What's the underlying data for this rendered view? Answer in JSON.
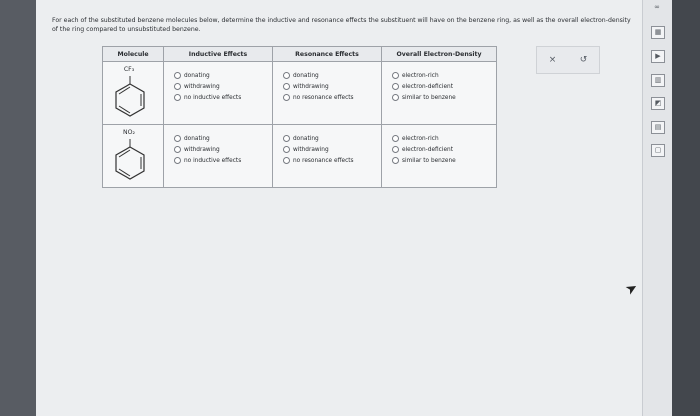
{
  "instructions": "For each of the substituted benzene molecules below, determine the inductive and resonance effects the substituent will have on the benzene ring, as well as the overall electron-density of the ring compared to unsubstituted benzene.",
  "table": {
    "headers": [
      "Molecule",
      "Inductive Effects",
      "Resonance Effects",
      "Overall Electron-Density"
    ],
    "rows": [
      {
        "substituent": "CF₃",
        "inductive": [
          "donating",
          "withdrawing",
          "no inductive effects"
        ],
        "resonance": [
          "donating",
          "withdrawing",
          "no resonance effects"
        ],
        "overall": [
          "electron-rich",
          "electron-deficient",
          "similar to benzene"
        ]
      },
      {
        "substituent": "NO₂",
        "inductive": [
          "donating",
          "withdrawing",
          "no inductive effects"
        ],
        "resonance": [
          "donating",
          "withdrawing",
          "no resonance effects"
        ],
        "overall": [
          "electron-rich",
          "electron-deficient",
          "similar to benzene"
        ]
      }
    ]
  },
  "actions": {
    "clear_symbol": "×",
    "undo_symbol": "↺"
  },
  "rail": {
    "top_symbol": "∞"
  }
}
